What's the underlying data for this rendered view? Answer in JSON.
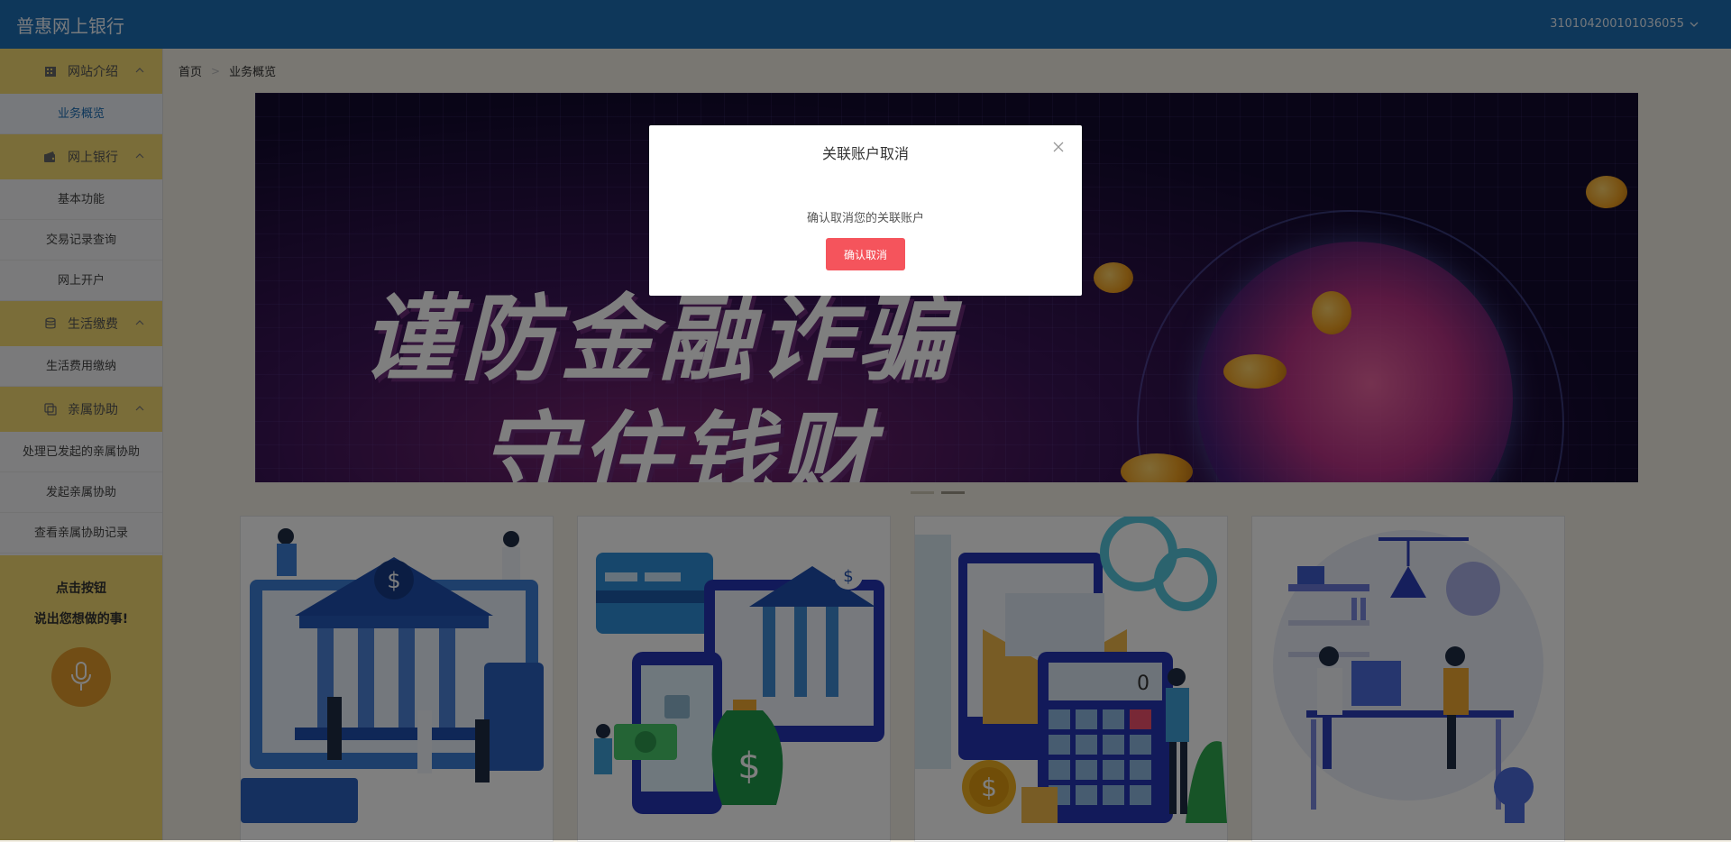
{
  "header": {
    "brand": "普惠网上银行",
    "account": "310104200101036055"
  },
  "breadcrumb": [
    "首页",
    "业务概览"
  ],
  "sidebar": {
    "groups": [
      {
        "label": "网站介绍",
        "icon": "building-icon",
        "items": [
          "业务概览"
        ]
      },
      {
        "label": "网上银行",
        "icon": "wallet-icon",
        "items": [
          "基本功能",
          "交易记录查询",
          "网上开户"
        ]
      },
      {
        "label": "生活缴费",
        "icon": "database-icon",
        "items": [
          "生活费用缴纳"
        ]
      },
      {
        "label": "亲属协助",
        "icon": "copy-icon",
        "items": [
          "处理已发起的亲属协助",
          "发起亲属协助",
          "查看亲属协助记录"
        ]
      }
    ],
    "active_item": "业务概览",
    "voice": {
      "line1": "点击按钮",
      "line2": "说出您想做的事!",
      "icon": "microphone-icon"
    }
  },
  "banner": {
    "slogan_line1": "谨防金融诈骗",
    "slogan_line2": "守住钱财"
  },
  "cards": [
    {
      "icon": "bank-building-illustration"
    },
    {
      "icon": "mobile-banking-illustration"
    },
    {
      "icon": "calculator-finance-illustration"
    },
    {
      "icon": "office-work-illustration"
    }
  ],
  "calculator_display": "0",
  "dialog": {
    "title": "关联账户取消",
    "message": "确认取消您的关联账户",
    "confirm_label": "确认取消"
  },
  "colors": {
    "header": "#1d6eb5",
    "sidebar_group": "#f4da73",
    "confirm": "#f5545c",
    "mic": "#e29b2a"
  }
}
